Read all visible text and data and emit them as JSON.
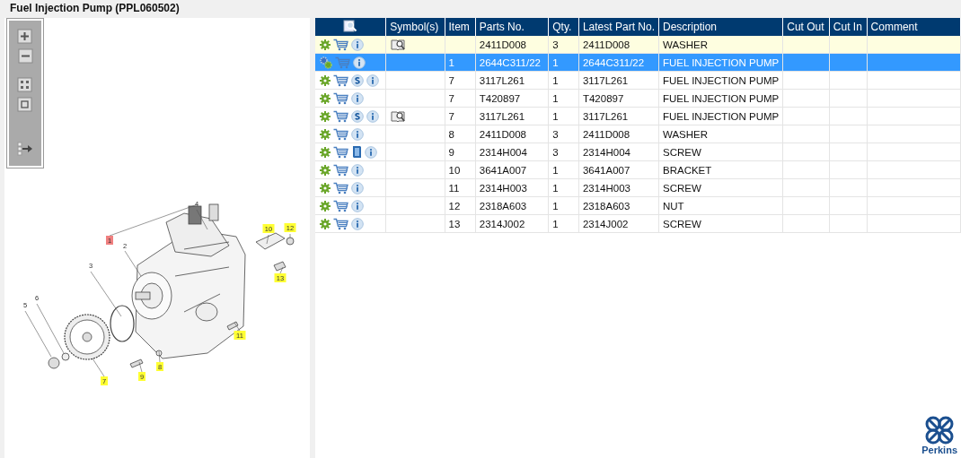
{
  "title": "Fuel Injection Pump (PPL060502)",
  "table": {
    "columns": [
      "Symbol(s)",
      "Item",
      "Parts No.",
      "Qty.",
      "Latest Part No.",
      "Description",
      "Cut Out",
      "Cut In",
      "Comment"
    ],
    "rows": [
      {
        "icons": [
          {
            "kind": "gear"
          },
          {
            "kind": "cart"
          },
          {
            "kind": "info"
          }
        ],
        "symbols": [
          {
            "kind": "catalog"
          }
        ],
        "parts_no": "2411D008",
        "qty": "3",
        "latest_part_no": "2411D008",
        "description": "WASHER",
        "highlighted": true,
        "selected": false
      },
      {
        "icons": [
          {
            "kind": "gears"
          },
          {
            "kind": "cart"
          },
          {
            "kind": "info"
          }
        ],
        "item": "1",
        "parts_no": "2644C311/22",
        "qty": "1",
        "latest_part_no": "2644C311/22",
        "description": "FUEL INJECTION PUMP",
        "highlighted": false,
        "selected": true
      },
      {
        "icons": [
          {
            "kind": "gear"
          },
          {
            "kind": "cart"
          },
          {
            "kind": "s"
          },
          {
            "kind": "info"
          }
        ],
        "item": "7",
        "parts_no": "3117L261",
        "qty": "1",
        "latest_part_no": "3117L261",
        "description": "FUEL INJECTION PUMP",
        "highlighted": false,
        "selected": false
      },
      {
        "icons": [
          {
            "kind": "gear"
          },
          {
            "kind": "cart"
          },
          {
            "kind": "info"
          }
        ],
        "item": "7",
        "parts_no": "T420897",
        "qty": "1",
        "latest_part_no": "T420897",
        "description": "FUEL INJECTION PUMP",
        "highlighted": false,
        "selected": false
      },
      {
        "icons": [
          {
            "kind": "gear"
          },
          {
            "kind": "cart"
          },
          {
            "kind": "s"
          },
          {
            "kind": "info"
          }
        ],
        "symbols": [
          {
            "kind": "catalog"
          }
        ],
        "item": "7",
        "parts_no": "3117L261",
        "qty": "1",
        "latest_part_no": "3117L261",
        "description": "FUEL INJECTION PUMP",
        "highlighted": false,
        "selected": false
      },
      {
        "icons": [
          {
            "kind": "gear"
          },
          {
            "kind": "cart"
          },
          {
            "kind": "info"
          }
        ],
        "item": "8",
        "parts_no": "2411D008",
        "qty": "3",
        "latest_part_no": "2411D008",
        "description": "WASHER",
        "highlighted": false,
        "selected": false
      },
      {
        "icons": [
          {
            "kind": "gear"
          },
          {
            "kind": "cart"
          },
          {
            "kind": "manual"
          },
          {
            "kind": "info"
          }
        ],
        "item": "9",
        "parts_no": "2314H004",
        "qty": "3",
        "latest_part_no": "2314H004",
        "description": "SCREW",
        "highlighted": false,
        "selected": false
      },
      {
        "icons": [
          {
            "kind": "gear"
          },
          {
            "kind": "cart"
          },
          {
            "kind": "info"
          }
        ],
        "item": "10",
        "parts_no": "3641A007",
        "qty": "1",
        "latest_part_no": "3641A007",
        "description": "BRACKET",
        "highlighted": false,
        "selected": false
      },
      {
        "icons": [
          {
            "kind": "gear"
          },
          {
            "kind": "cart"
          },
          {
            "kind": "info"
          }
        ],
        "item": "11",
        "parts_no": "2314H003",
        "qty": "1",
        "latest_part_no": "2314H003",
        "description": "SCREW",
        "highlighted": false,
        "selected": false
      },
      {
        "icons": [
          {
            "kind": "gear"
          },
          {
            "kind": "cart"
          },
          {
            "kind": "info"
          }
        ],
        "item": "12",
        "parts_no": "2318A603",
        "qty": "1",
        "latest_part_no": "2318A603",
        "description": "NUT",
        "highlighted": false,
        "selected": false
      },
      {
        "icons": [
          {
            "kind": "gear"
          },
          {
            "kind": "cart"
          },
          {
            "kind": "info"
          }
        ],
        "item": "13",
        "parts_no": "2314J002",
        "qty": "1",
        "latest_part_no": "2314J002",
        "description": "SCREW",
        "highlighted": false,
        "selected": false
      }
    ]
  },
  "diagram": {
    "callouts": [
      {
        "text": "1",
        "kind": "selected"
      },
      {
        "text": "2",
        "kind": "plain"
      },
      {
        "text": "3",
        "kind": "plain"
      },
      {
        "text": "4",
        "kind": "plain"
      },
      {
        "text": "5",
        "kind": "plain"
      },
      {
        "text": "6",
        "kind": "plain"
      },
      {
        "text": "7",
        "kind": "hotspot"
      },
      {
        "text": "8",
        "kind": "hotspot"
      },
      {
        "text": "9",
        "kind": "hotspot"
      },
      {
        "text": "10",
        "kind": "hotspot"
      },
      {
        "text": "11",
        "kind": "hotspot"
      },
      {
        "text": "12",
        "kind": "hotspot"
      },
      {
        "text": "13",
        "kind": "hotspot"
      }
    ]
  },
  "logo": {
    "text": "Perkins"
  }
}
